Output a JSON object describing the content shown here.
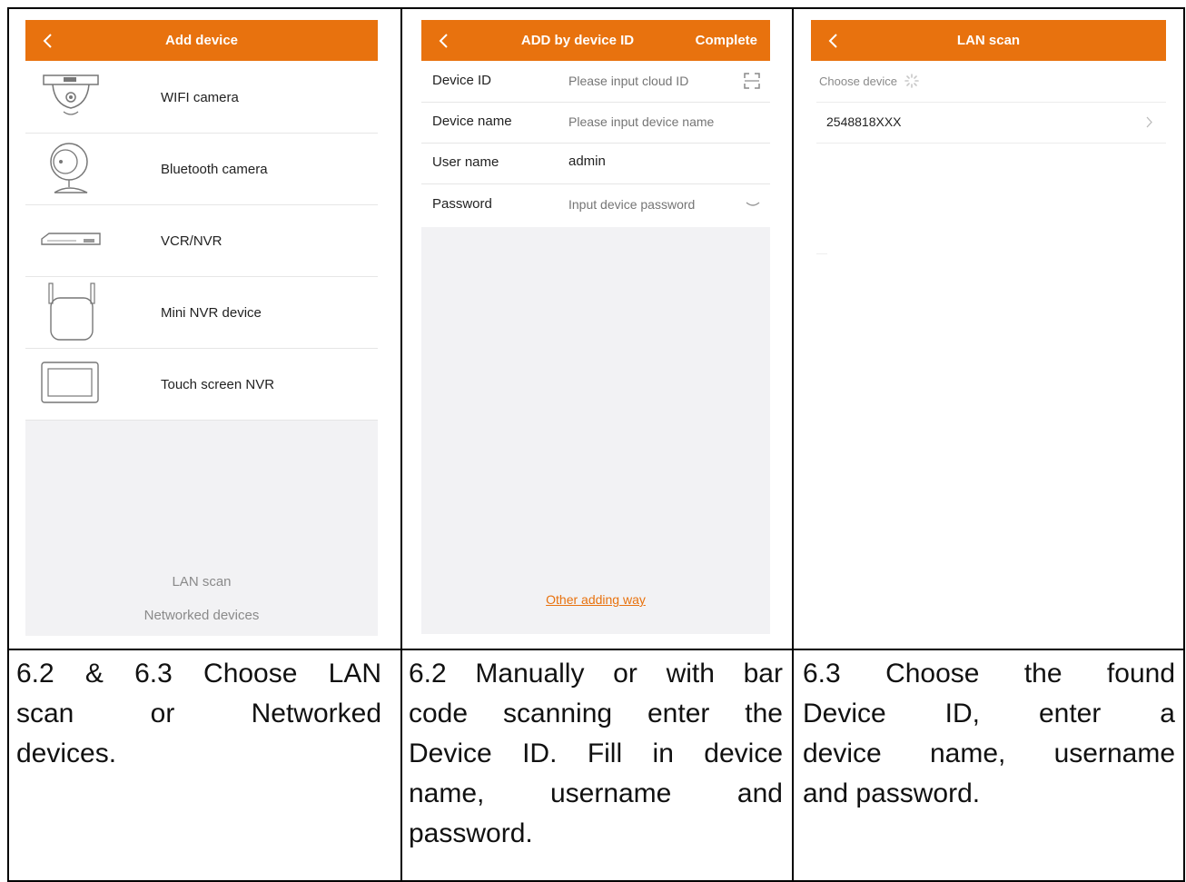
{
  "colors": {
    "accent": "#e8720e",
    "panel_gray": "#f2f2f4",
    "divider": "#e6e6e6"
  },
  "screen1": {
    "title": "Add device",
    "devices": [
      {
        "label": "WIFI camera",
        "icon": "dome-camera-icon"
      },
      {
        "label": "Bluetooth camera",
        "icon": "bluetooth-camera-icon"
      },
      {
        "label": "VCR/NVR",
        "icon": "nvr-box-icon"
      },
      {
        "label": "Mini NVR device",
        "icon": "mini-nvr-icon"
      },
      {
        "label": "Touch screen NVR",
        "icon": "touch-screen-nvr-icon"
      }
    ],
    "lan_scan": "LAN scan",
    "networked_devices": "Networked devices"
  },
  "screen2": {
    "title": "ADD by device ID",
    "complete": "Complete",
    "fields": [
      {
        "label": "Device ID",
        "placeholder": "Please input cloud ID",
        "value": ""
      },
      {
        "label": "Device name",
        "placeholder": "Please input device name",
        "value": ""
      },
      {
        "label": "User name",
        "placeholder": "",
        "value": "admin"
      },
      {
        "label": "Password",
        "placeholder": "Input device password",
        "value": ""
      }
    ],
    "other_way": "Other adding way"
  },
  "screen3": {
    "title": "LAN scan",
    "choose_device": "Choose device",
    "found_device": "2548818XXX"
  },
  "captions": {
    "col1": [
      "6.2 & 6.3 Choose LAN",
      "scan or Networked",
      "devices."
    ],
    "col2": [
      "6.2 Manually or with bar",
      "code scanning enter the",
      "Device ID. Fill in device",
      "name, username and",
      "password."
    ],
    "col3": [
      "6.3 Choose the found",
      "Device ID, enter a",
      "device name, username",
      "and password."
    ]
  }
}
